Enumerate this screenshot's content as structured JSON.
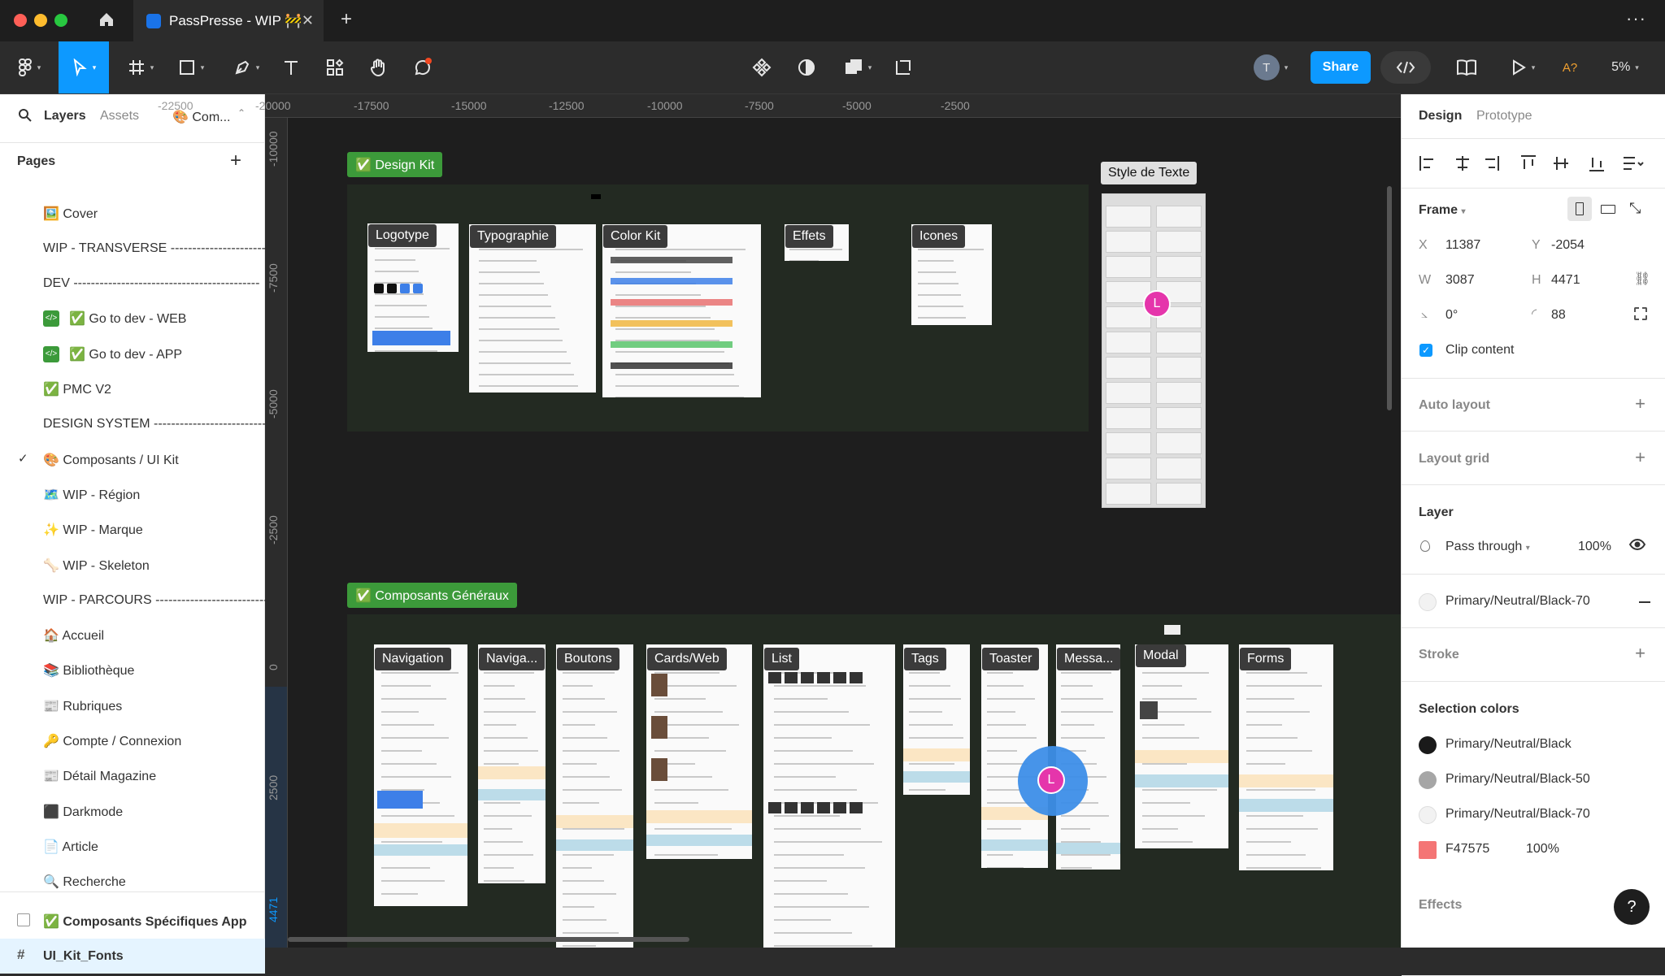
{
  "window": {
    "tab_title": "PassPresse - WIP 🚧"
  },
  "toolbar": {
    "avatar_letter": "T",
    "share_label": "Share",
    "ai_label": "A?",
    "zoom": "5%"
  },
  "left_panel": {
    "tabs": [
      "Layers",
      "Assets",
      "🎨 Com..."
    ],
    "pages_header": "Pages",
    "pages": [
      "🖼️ Cover",
      "WIP - TRANSVERSE -------------------------------",
      "DEV  -------------------------------------------",
      "✅ Go to dev - WEB",
      "✅ Go to dev - APP",
      "✅ PMC V2",
      "DESIGN SYSTEM ------------------------------",
      "🎨 Composants / UI Kit",
      "🗺️ WIP - Région",
      "✨ WIP - Marque",
      "🦴 WIP - Skeleton",
      "WIP - PARCOURS ------------------------------",
      "🏠 Accueil",
      "📚 Bibliothèque",
      "📰 Rubriques",
      "🔑 Compte / Connexion",
      "📰 Détail Magazine",
      "⬛ Darkmode",
      "📄 Article",
      "🔍 Recherche"
    ],
    "layers": [
      "✅ Composants Spécifiques App",
      "UI_Kit_Fonts"
    ]
  },
  "rulers": {
    "top": [
      "-22500",
      "-20000",
      "-17500",
      "-15000",
      "-12500",
      "-10000",
      "-7500",
      "-5000",
      "-2500"
    ],
    "left": [
      "-10000",
      "-7500",
      "-5000",
      "-2500",
      "0",
      "2500",
      "4471"
    ]
  },
  "canvas": {
    "sections": [
      "✅  Design Kit",
      "✅  Composants Généraux"
    ],
    "design_kit_frames": [
      "Logotype",
      "Typographie",
      "Color Kit",
      "Effets",
      "Icones"
    ],
    "style_frame": "Style de Texte",
    "general_frames": [
      "Navigation",
      "Naviga...",
      "Boutons",
      "Cards/Web",
      "List",
      "Tags",
      "Toaster",
      "Messa...",
      "Modal",
      "Forms"
    ],
    "cursor_letter": "L"
  },
  "right_panel": {
    "tabs": [
      "Design",
      "Prototype"
    ],
    "frame_label": "Frame",
    "x_label": "X",
    "x": "11387",
    "y_label": "Y",
    "y": "-2054",
    "w_label": "W",
    "w": "3087",
    "h_label": "H",
    "h": "4471",
    "rotation": "0°",
    "radius": "88",
    "clip_content": "Clip content",
    "auto_layout": "Auto layout",
    "layout_grid": "Layout grid",
    "layer_header": "Layer",
    "blend_mode": "Pass through",
    "opacity": "100%",
    "fill_style": "Primary/Neutral/Black-70",
    "stroke": "Stroke",
    "selection_colors_header": "Selection colors",
    "selection_colors": [
      {
        "name": "Primary/Neutral/Black",
        "color": "#1a1a1a"
      },
      {
        "name": "Primary/Neutral/Black-50",
        "color": "#a6a6a6"
      },
      {
        "name": "Primary/Neutral/Black-70",
        "color": "#f2f2f2"
      },
      {
        "name": "F47575",
        "color": "#F47575",
        "opacity": "100%"
      }
    ],
    "effects": "Effects"
  },
  "colors": {
    "accent": "#0d99ff",
    "section_tag": "#3c9a3a",
    "cursor": "#e535ab"
  }
}
